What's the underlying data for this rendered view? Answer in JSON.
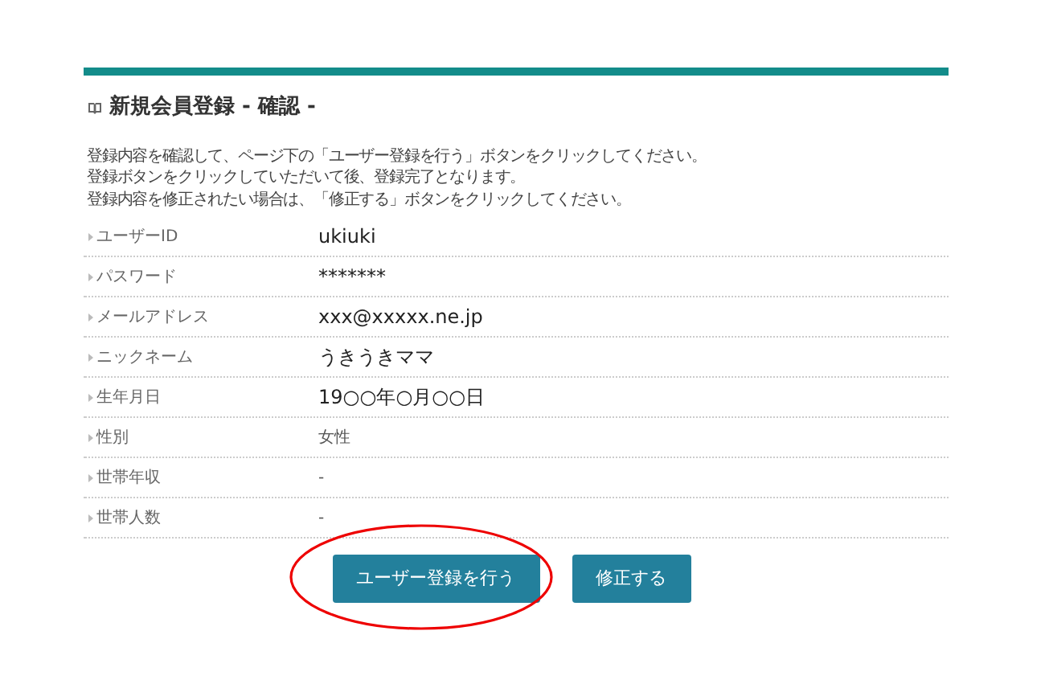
{
  "title": "新規会員登録 - 確認 -",
  "intro": [
    "登録内容を確認して、ページ下の「ユーザー登録を行う」ボタンをクリックしてください。",
    "登録ボタンをクリックしていただいて後、登録完了となります。",
    "登録内容を修正されたい場合は、「修正する」ボタンをクリックしてください。"
  ],
  "rows": [
    {
      "label": "ユーザーID",
      "value": "ukiuki",
      "kind": "entered"
    },
    {
      "label": "パスワード",
      "value": "*******",
      "kind": "entered"
    },
    {
      "label": "メールアドレス",
      "value": "xxx@xxxxx.ne.jp",
      "kind": "entered"
    },
    {
      "label": "ニックネーム",
      "value": "うきうきママ",
      "kind": "entered"
    },
    {
      "label": "生年月日",
      "value": "19○○年○月○○日",
      "kind": "entered"
    },
    {
      "label": "性別",
      "value": "女性",
      "kind": "choice"
    },
    {
      "label": "世帯年収",
      "value": "-",
      "kind": "choice"
    },
    {
      "label": "世帯人数",
      "value": "-",
      "kind": "choice"
    }
  ],
  "buttons": [
    {
      "label": "ユーザー登録を行う",
      "circled": true
    },
    {
      "label": "修正する",
      "circled": false
    }
  ]
}
